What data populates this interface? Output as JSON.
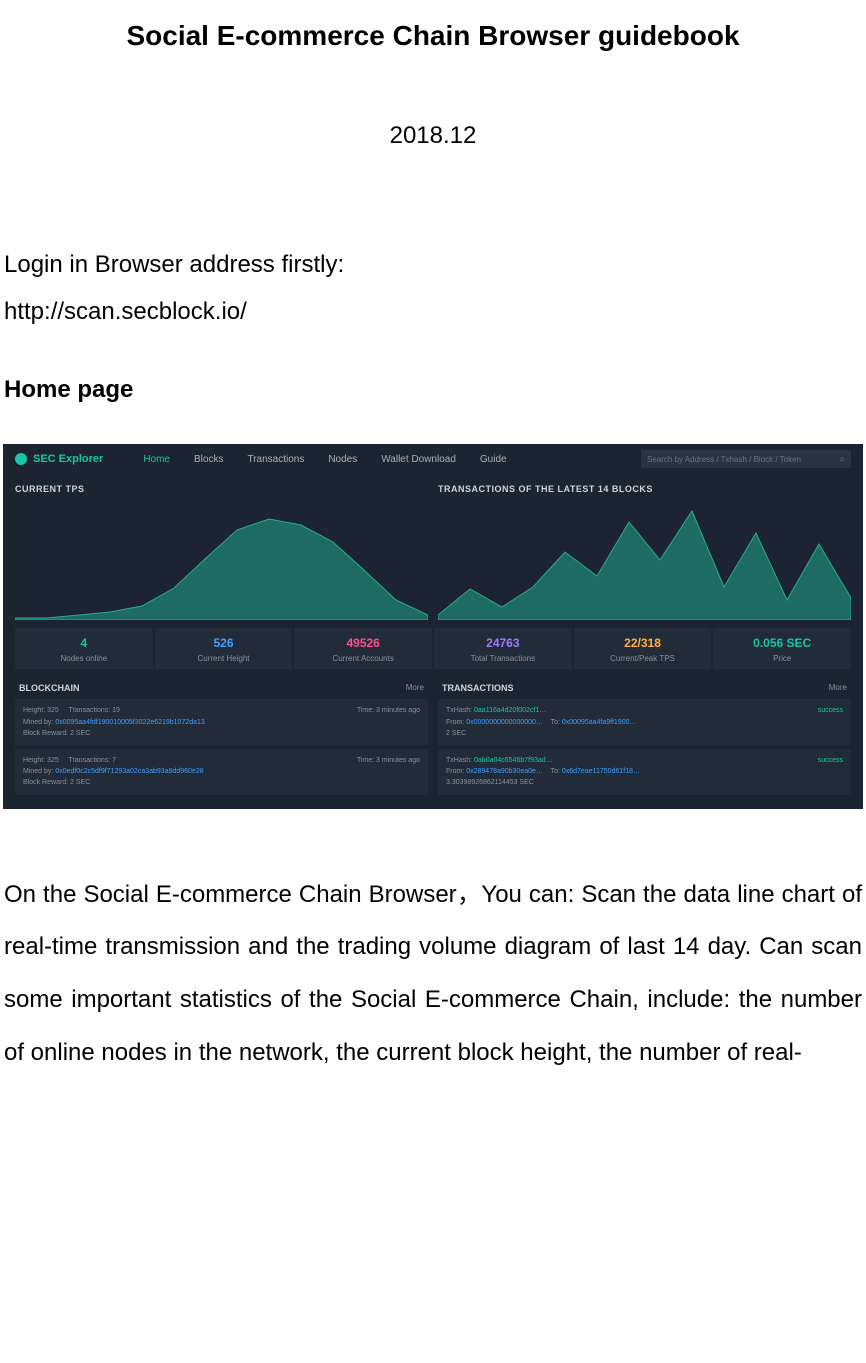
{
  "doc": {
    "title": "Social E-commerce Chain Browser guidebook",
    "date": "2018.12",
    "intro_line": "Login in Browser address firstly:",
    "url": "http://scan.secblock.io/",
    "heading": "Home page",
    "body": "On the Social E-commerce Chain Browser，You can: Scan the data line chart of real-time transmission and the trading volume diagram of last 14 day. Can scan some important statistics of the Social E-commerce Chain, include: the number of online nodes in the network, the current block height, the number of real-"
  },
  "app": {
    "logo_text": "SEC Explorer",
    "nav": {
      "home": "Home",
      "blocks": "Blocks",
      "transactions": "Transactions",
      "nodes": "Nodes",
      "wallet": "Wallet Download",
      "guide": "Guide"
    },
    "search_placeholder": "Search by Address / Txhash / Block / Token"
  },
  "charts": {
    "left_title": "CURRENT TPS",
    "right_title": "TRANSACTIONS OF THE LATEST 14 BLOCKS"
  },
  "stats": [
    {
      "value": "4",
      "label": "Nodes online"
    },
    {
      "value": "526",
      "label": "Current Height"
    },
    {
      "value": "49526",
      "label": "Current Accounts"
    },
    {
      "value": "24763",
      "label": "Total Transactions"
    },
    {
      "value": "22/318",
      "label": "Current/Peak TPS"
    },
    {
      "value": "0.056 SEC",
      "label": "Price"
    }
  ],
  "blockchain": {
    "title": "BLOCKCHAIN",
    "more": "More",
    "rows": [
      {
        "height_label": "Height:",
        "height": "325",
        "tx_label": "Transactions:",
        "tx": "19",
        "mined_label": "Mined by:",
        "mined": "0x0095aa4fdf190010005f3022e6219b1072da13",
        "reward_label": "Block Reward:",
        "reward": "2 SEC",
        "time": "Time: 3 minutes ago"
      },
      {
        "height_label": "Height:",
        "height": "325",
        "tx_label": "Transactions:",
        "tx": "7",
        "mined_label": "Mined by:",
        "mined": "0x0edf0c2c5df9f71293a02ca3ab93a9dd960e28",
        "reward_label": "Block Reward:",
        "reward": "2 SEC",
        "time": "Time: 3 minutes ago"
      }
    ]
  },
  "transactions": {
    "title": "TRANSACTIONS",
    "more": "More",
    "rows": [
      {
        "hash_label": "TxHash:",
        "hash": "0aa116a4d20f002cf1…",
        "from_label": "From:",
        "from": "0x0000000000000000…",
        "to_label": "To:",
        "to": "0x00095aa4fa9ff1900…",
        "amount": "2 SEC",
        "status": "success"
      },
      {
        "hash_label": "TxHash:",
        "hash": "0ab0a04c6546b7f93ad…",
        "from_label": "From:",
        "from": "0x289478a90b30ea0e…",
        "to_label": "To:",
        "to": "0x6d7eae11750d61f18…",
        "amount": "3.30398926862114453 SEC",
        "status": "success"
      }
    ]
  },
  "chart_data": [
    {
      "type": "area",
      "title": "CURRENT TPS",
      "xlabel": "",
      "ylabel": "",
      "x": [
        0,
        1,
        2,
        3,
        4,
        5,
        6,
        7,
        8,
        9,
        10,
        11,
        12,
        13
      ],
      "values": [
        2,
        2,
        3,
        4,
        6,
        12,
        22,
        32,
        36,
        34,
        28,
        18,
        8,
        3
      ],
      "ylim": [
        0,
        40
      ],
      "colors": {
        "fill": "#1e6b63",
        "stroke": "#2aa893"
      }
    },
    {
      "type": "area",
      "title": "TRANSACTIONS OF THE LATEST 14 BLOCKS",
      "xlabel": "",
      "ylabel": "",
      "x": [
        0,
        1,
        2,
        3,
        4,
        5,
        6,
        7,
        8,
        9,
        10,
        11,
        12,
        13
      ],
      "values": [
        5,
        28,
        12,
        30,
        62,
        40,
        90,
        55,
        100,
        30,
        80,
        18,
        70,
        20
      ],
      "ylim": [
        0,
        110
      ],
      "colors": {
        "fill": "#1e6b63",
        "stroke": "#2aa893"
      }
    }
  ]
}
